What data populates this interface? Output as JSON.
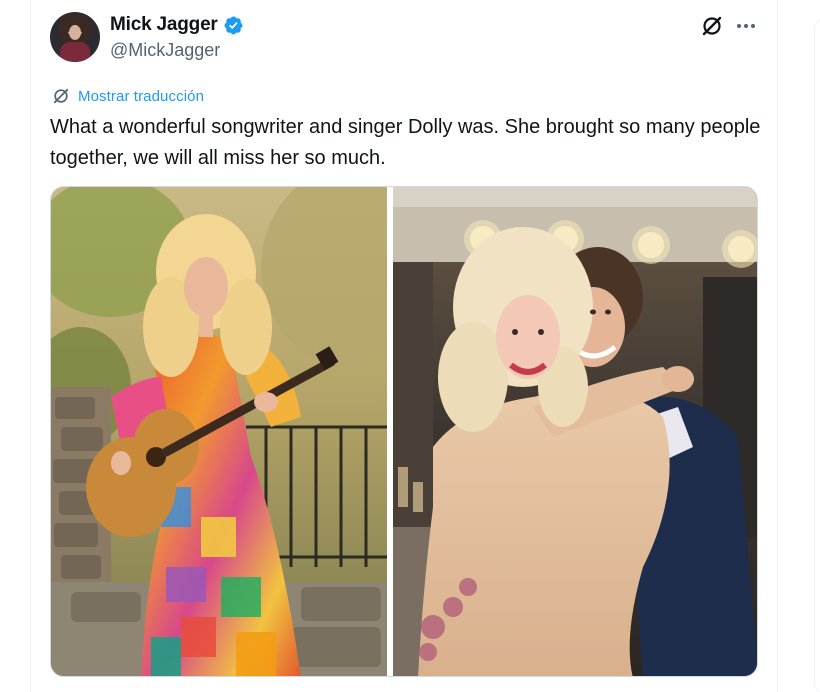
{
  "author": {
    "display_name": "Mick Jagger",
    "handle": "@MickJagger",
    "verified": true,
    "verified_color": "#1d9bf0"
  },
  "actions": {
    "grok_icon": "grok-icon",
    "more_icon": "more-horizontal-icon"
  },
  "translate": {
    "label": "Mostrar traducción",
    "icon": "translate-icon",
    "color": "#1d9bf0"
  },
  "tweet": {
    "text": "What a wonderful songwriter and singer Dolly was. She brought so many people together, we will all miss her so much."
  },
  "media": {
    "count": 2
  }
}
